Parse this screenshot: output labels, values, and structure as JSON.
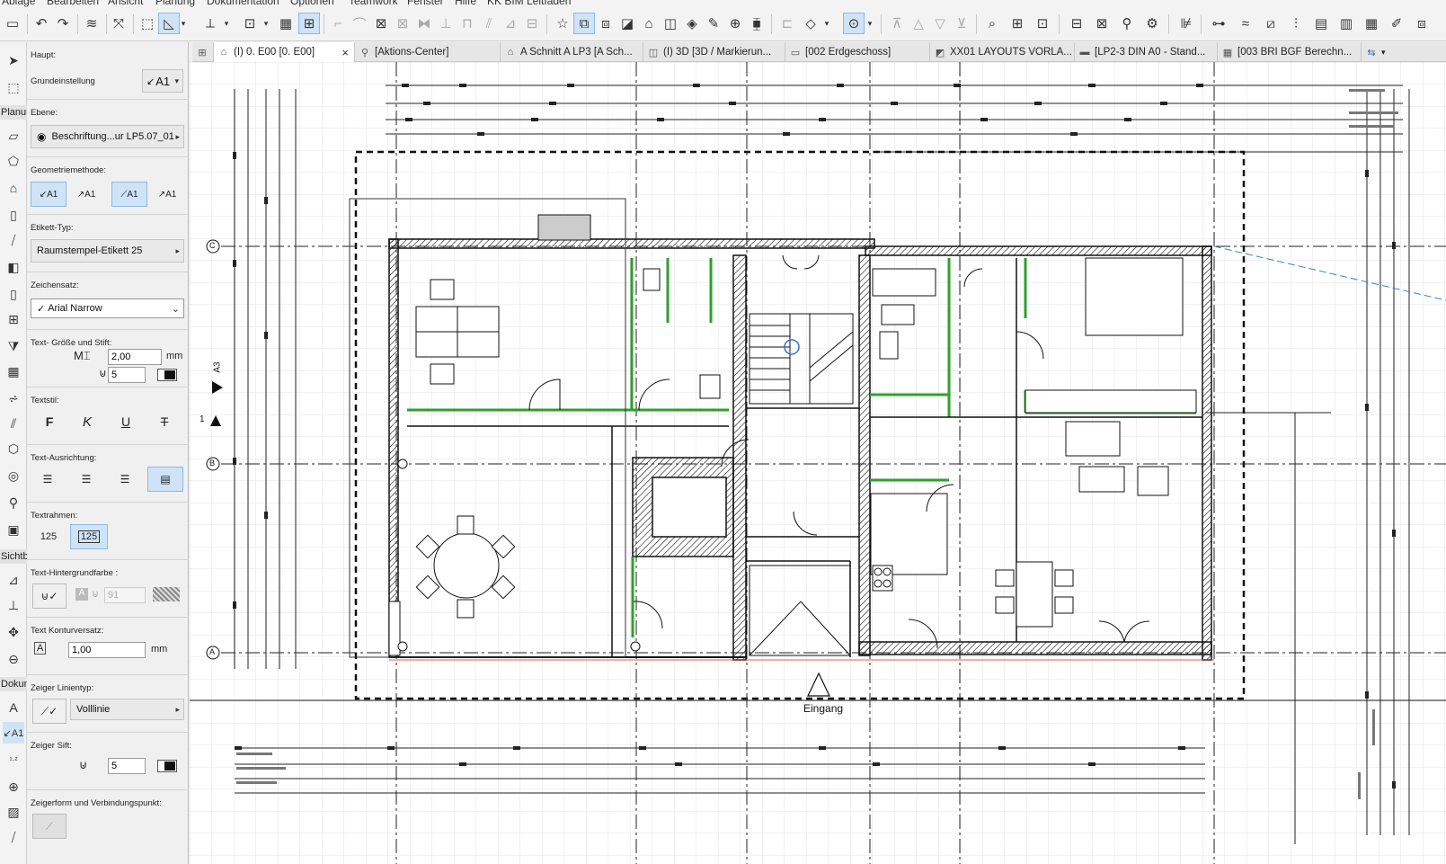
{
  "menubar": {
    "items": [
      "Ablage",
      "Bearbeiten",
      "Ansicht",
      "Planung",
      "Dokumentation",
      "Optionen",
      "Teamwork",
      "Fenster",
      "Hilfe",
      "KK BIM Leitfaden"
    ]
  },
  "tabs": [
    {
      "label": "(I) 0. E00 [0. E00]",
      "icon": "floorplan-icon",
      "active": true,
      "close": "×"
    },
    {
      "label": "[Aktions-Center]",
      "icon": "action-center-icon"
    },
    {
      "label": "A Schnitt A LP3 [A Sch...",
      "icon": "section-icon"
    },
    {
      "label": "(I) 3D [3D / Markierun...",
      "icon": "3d-icon"
    },
    {
      "label": "[002 Erdgeschoss]",
      "icon": "layout-icon"
    },
    {
      "label": "XX01 LAYOUTS VORLA...",
      "icon": "master-layout-icon"
    },
    {
      "label": "[LP2-3 DIN A0 - Stand...",
      "icon": "layout-sheet-icon"
    },
    {
      "label": "[003 BRI BGF Berechn...",
      "icon": "schedule-icon"
    }
  ],
  "toolbox": {
    "groups": [
      "Planung",
      "Sichtbarkeit",
      "Dokumentation"
    ]
  },
  "infobox": {
    "haupt": "Haupt:",
    "grundeinstellung": "Grundeinstellung",
    "grundeinstellung_value": "A1",
    "ebene_label": "Ebene:",
    "ebene_value": "Beschriftung...ur LP5.07_01",
    "geometrie_label": "Geometriemethode:",
    "etikett_label": "Etikett-Typ:",
    "etikett_value": "Raumstempel-Etikett 25",
    "zeichensatz_label": "Zeichensatz:",
    "zeichensatz_value": "Arial Narrow",
    "textgroesse_label": "Text- Größe und Stift:",
    "textgroesse_value": "2,00",
    "textgroesse_unit": "mm",
    "stift_value": "5",
    "textstil_label": "Textstil:",
    "style_bold": "F",
    "style_italic": "K",
    "style_underline": "U",
    "style_strike": "T",
    "ausrichtung_label": "Text-Ausrichtung:",
    "textrahmen_label": "Textrahmen:",
    "rahmen_off": "125",
    "rahmen_on": "125",
    "hintergrund_label": "Text-Hintergrundfarbe :",
    "hintergrund_value": "91",
    "kontur_label": "Text Konturversatz:",
    "kontur_value": "1,00",
    "kontur_unit": "mm",
    "linientyp_label": "Zeiger Linientyp:",
    "linientyp_value": "Volllinie",
    "zeigerstift_label": "Zeiger Sift:",
    "zeigerstift_value": "5",
    "zeigerform_label": "Zeigerform und Verbindungspunkt:"
  },
  "canvas": {
    "grid_labels": [
      "C",
      "B",
      "A"
    ],
    "section_marker": "A3",
    "marker_1": "1",
    "entrance_label": "Eingang"
  },
  "colors": {
    "accent": "#cfe3f7",
    "wall": "#111111",
    "partition": "#2da12d",
    "grid": "#e3e3e3"
  }
}
